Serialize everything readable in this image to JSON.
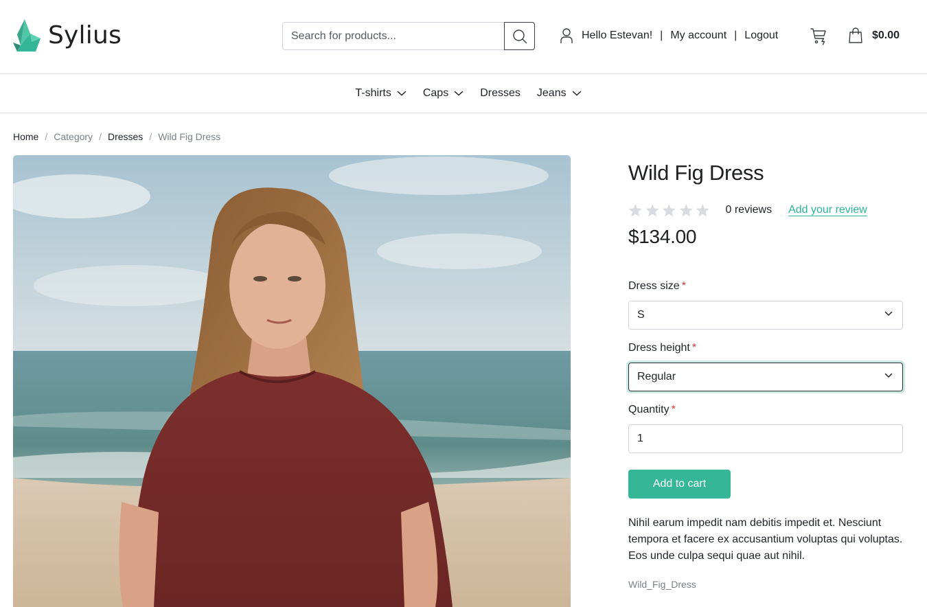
{
  "brand": {
    "name": "Sylius",
    "accent": "#35b797"
  },
  "search": {
    "placeholder": "Search for products...",
    "value": ""
  },
  "user": {
    "greeting": "Hello Estevan!",
    "account": "My account",
    "logout": "Logout"
  },
  "cart": {
    "total": "$0.00"
  },
  "nav": [
    {
      "label": "T-shirts",
      "dropdown": true
    },
    {
      "label": "Caps",
      "dropdown": true
    },
    {
      "label": "Dresses",
      "dropdown": false
    },
    {
      "label": "Jeans",
      "dropdown": true
    }
  ],
  "breadcrumb": {
    "home": "Home",
    "category": "Category",
    "dresses": "Dresses",
    "current": "Wild Fig Dress",
    "separator": "/"
  },
  "product": {
    "title": "Wild Fig Dress",
    "rating": 0,
    "rating_max": 5,
    "reviews": "0 reviews",
    "add_review": "Add your review",
    "price": "$134.00",
    "size_label": "Dress size",
    "size_value": "S",
    "height_label": "Dress height",
    "height_value": "Regular",
    "quantity_label": "Quantity",
    "quantity_value": "1",
    "required_mark": "*",
    "add_to_cart": "Add to cart",
    "description": "Nihil earum impedit nam debitis impedit et. Nesciunt tempora et facere ex accusantium voluptas qui voluptas. Eos unde culpa sequi quae aut nihil.",
    "code": "Wild_Fig_Dress"
  }
}
